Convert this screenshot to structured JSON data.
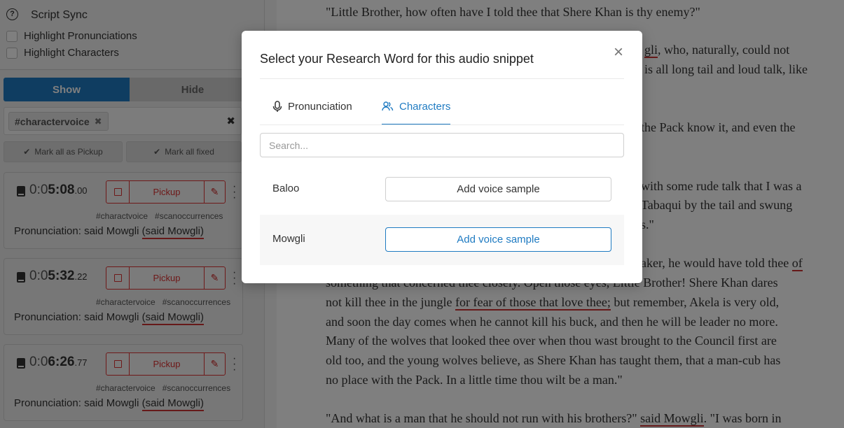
{
  "sidebar": {
    "title": "Script Sync",
    "highlight_pronunciations": "Highlight Pronunciations",
    "highlight_characters": "Highlight Characters",
    "show_label": "Show",
    "hide_label": "Hide",
    "filter_tag": "#charactervoice",
    "mark_all_pickup": "Mark all as Pickup",
    "mark_all_fixed": "Mark all fixed",
    "cards": [
      {
        "time_prefix": "0:0",
        "time_main": "5:08",
        "time_ms": ".00",
        "pickup": "Pickup",
        "tag1": "#charactvoice",
        "tag2": "#scanoccurrences",
        "pron_label": "Pronunciation: said Mowgli",
        "pron_ref": "(said Mowgli)"
      },
      {
        "time_prefix": "0:0",
        "time_main": "5:32",
        "time_ms": ".22",
        "pickup": "Pickup",
        "tag1": "#charactervoice",
        "tag2": "#scanoccurrences",
        "pron_label": "Pronunciation: said Mowgli",
        "pron_ref": "(said Mowgli)"
      },
      {
        "time_prefix": "0:0",
        "time_main": "6:26",
        "time_ms": ".77",
        "pickup": "Pickup",
        "tag1": "#charactervoice",
        "tag2": "#scanoccurrences",
        "pron_label": "Pronunciation: said Mowgli",
        "pron_ref": "(said Mowgli)"
      }
    ]
  },
  "document": {
    "l1": "\"Little Brother, how often have I told thee that Shere Khan is thy enemy?\"",
    "l2a_u": "gli",
    "l2a": ", who, naturally, could not",
    "l2b": " is all long tail and loud talk, like",
    "l3": " the Pack know it, and even the",
    "l4a": "with some rude talk that I was a",
    "l4b": "Tabaqui by the tail and swung",
    "l4c": "s.\"",
    "l5": "aker, he would have told thee ",
    "l5_u": "of",
    "l6": "something that concerned thee closely. Open those eyes, Little Brother! Shere Khan dares",
    "l7a": "not kill thee in the jungle ",
    "l7_u": "for fear of those that love thee;",
    "l7b": " but remember, Akela is very old,",
    "l8": "and soon the day comes when he cannot kill his buck, and then he will be leader no more.",
    "l9": "Many of the wolves that looked thee over when thou wast brought to the Council first are",
    "l10": "old too, and the young wolves believe, as Shere Khan has taught them, that a man-cub has",
    "l11": "no place with the Pack. In a little time thou wilt be a man.\"",
    "l12a": "\"And what is a man that he should not run with his brothers?\" ",
    "l12_u": "said Mowgli",
    "l12b": ". \"I was born in"
  },
  "modal": {
    "title": "Select your Research Word for this audio snippet",
    "close": "×",
    "tab_pronunciation": "Pronunciation",
    "tab_characters": "Characters",
    "search_placeholder": "Search...",
    "rows": [
      {
        "name": "Baloo",
        "button": "Add voice sample"
      },
      {
        "name": "Mowgli",
        "button": "Add voice sample"
      }
    ]
  },
  "colors": {
    "accent": "#1f7bc2",
    "pickup_red": "#d33",
    "underline_red": "#c33"
  }
}
